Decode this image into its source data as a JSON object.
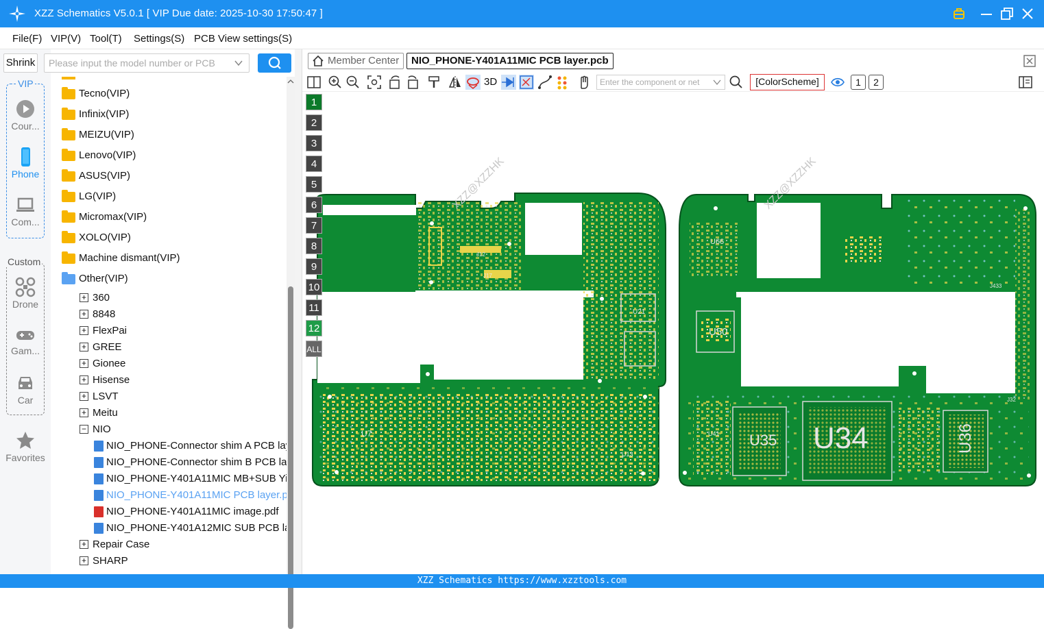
{
  "window": {
    "title": "XZZ Schematics V5.0.1 [ VIP Due date: 2025-10-30 17:50:47 ]"
  },
  "menu": [
    "File(F)",
    "VIP(V)",
    "Tool(T)",
    "Settings(S)",
    "PCB View settings(S)"
  ],
  "sidebar": {
    "shrink_label": "Shrink",
    "vip_label": "VIP",
    "custom_label": "Custom",
    "items": [
      "Cour...",
      "Phone",
      "Com...",
      "Drone",
      "Gam...",
      "Car",
      "Favorites"
    ]
  },
  "search": {
    "placeholder": "Please input the model number or PCB"
  },
  "tree": {
    "brands": [
      "Tecno(VIP)",
      "Infinix(VIP)",
      "MEIZU(VIP)",
      "Lenovo(VIP)",
      "ASUS(VIP)",
      "LG(VIP)",
      "Micromax(VIP)",
      "XOLO(VIP)",
      "Machine dismant(VIP)",
      "Other(VIP)"
    ],
    "subs": [
      "360",
      "8848",
      "FlexPai",
      "GREE",
      "Gionee",
      "Hisense",
      "LSVT",
      "Meitu",
      "NIO"
    ],
    "files": [
      "NIO_PHONE-Connector shim A PCB layer.pcb",
      "NIO_PHONE-Connector shim B PCB layer.pcb",
      "NIO_PHONE-Y401A11MIC MB+SUB YiDong.pcb",
      "NIO_PHONE-Y401A11MIC PCB layer.pcb",
      "NIO_PHONE-Y401A11MIC image.pdf",
      "NIO_PHONE-Y401A12MIC SUB PCB layer.pcb"
    ],
    "after": [
      "Repair Case",
      "SHARP"
    ]
  },
  "tabs": {
    "member": "Member Center",
    "active": "NIO_PHONE-Y401A11MIC PCB layer.pcb"
  },
  "toolbar": {
    "three_d": "3D",
    "component_placeholder": "Enter the component or net",
    "colorscheme": "[ColorScheme]",
    "pages": [
      "1",
      "2"
    ]
  },
  "layers": [
    "1",
    "2",
    "3",
    "4",
    "5",
    "6",
    "7",
    "8",
    "9",
    "10",
    "11",
    "12",
    "ALL"
  ],
  "pcb": {
    "watermark": "XZZ@XZZHK",
    "labels": [
      "U66",
      "U50",
      "U35",
      "U34",
      "U36",
      "U21",
      "J12",
      "J17",
      "U7",
      "U13",
      "J433",
      "J32",
      "U41"
    ]
  },
  "footer": {
    "text": "XZZ Schematics https://www.xzztools.com"
  },
  "colors": {
    "brand": "#1e90f0",
    "pcb_green": "#0e8a33",
    "pad_gold": "#e8d44a"
  }
}
